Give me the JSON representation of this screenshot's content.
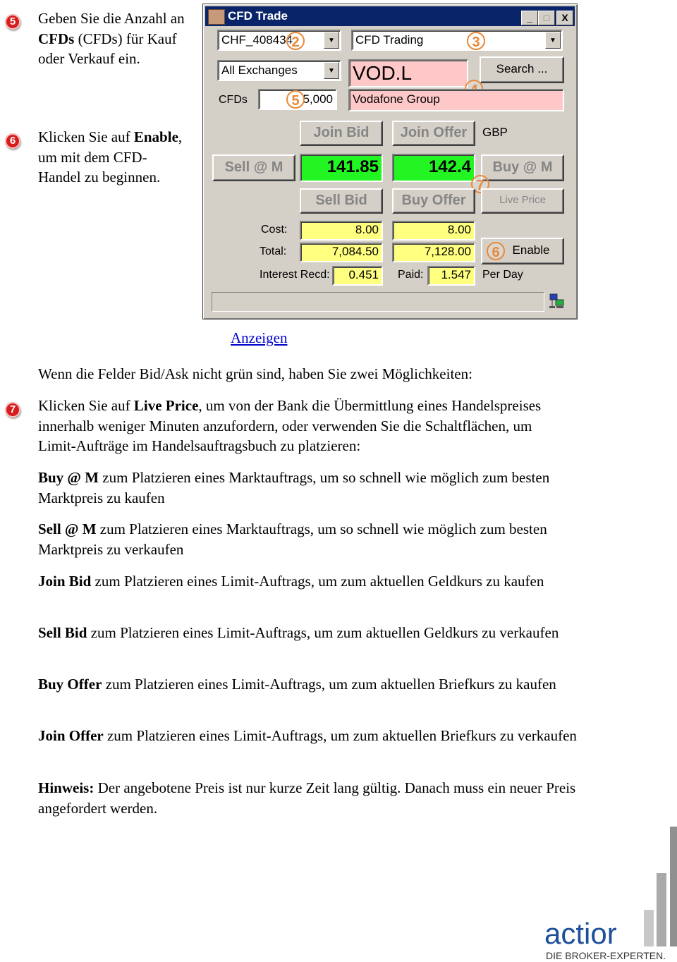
{
  "steps": {
    "step5": {
      "number": "5",
      "text_before": "Geben Sie die Anzahl an ",
      "bold": "CFDs",
      "text_after": " (CFDs) für Kauf oder Verkauf ein."
    },
    "step6": {
      "number": "6",
      "text_before": "Klicken Sie auf ",
      "bold": "Enable",
      "text_after": ", um mit dem CFD-Handel zu beginnen."
    }
  },
  "window": {
    "title": "CFD Trade",
    "minimize": "_",
    "maximize": "□",
    "close": "X",
    "account_select": "CHF_408434",
    "product_select": "CFD Trading",
    "exchange_select": "All Exchanges",
    "symbol": "VOD.L",
    "search_button": "Search ...",
    "cfds_label": "CFDs",
    "cfds_value": "5,000",
    "instrument_name": "Vodafone Group",
    "join_bid": "Join Bid",
    "join_offer": "Join Offer",
    "currency": "GBP",
    "sell_at_market": "Sell @ M",
    "bid_price": "141.85",
    "offer_price": "142.4",
    "buy_at_market": "Buy @ M",
    "sell_bid": "Sell Bid",
    "buy_offer": "Buy Offer",
    "live_price": "Live Price",
    "cost_label": "Cost:",
    "cost_bid": "8.00",
    "cost_offer": "8.00",
    "total_label": "Total:",
    "total_bid": "7,084.50",
    "total_offer": "7,128.00",
    "enable_button": "Enable",
    "interest_label": "Interest Recd:",
    "interest_recd": "0.451",
    "paid_label": "Paid:",
    "paid": "1.547",
    "per_day": "Per Day",
    "status_text": "",
    "callouts": [
      "2",
      "3",
      "4",
      "5",
      "6",
      "7"
    ]
  },
  "link": "Anzeigen",
  "intro": "Wenn die Felder Bid/Ask nicht grün sind, haben Sie zwei Möglichkeiten:",
  "step7": {
    "number": "7",
    "text_before": "Klicken Sie auf ",
    "bold": "Live Price",
    "text_after": ", um von der Bank die Übermittlung eines Handelspreises innerhalb weniger Minuten anzufordern, oder verwenden Sie die Schaltflächen, um Limit-Aufträge im Handelsauftragsbuch zu platzieren:"
  },
  "definitions": [
    {
      "term": "Buy @ M",
      "text": " zum Platzieren eines Marktauftrags, um so schnell wie möglich zum besten Marktpreis zu kaufen"
    },
    {
      "term": "Sell @ M",
      "text": " zum Platzieren eines Marktauftrags, um so schnell wie möglich zum besten Marktpreis zu verkaufen"
    },
    {
      "term": "Join Bid",
      "text": " zum Platzieren eines Limit-Auftrags, um zum aktuellen Geldkurs zu kaufen"
    },
    {
      "term": "Sell Bid",
      "text": " zum Platzieren eines Limit-Auftrags, um zum aktuellen Geldkurs zu verkaufen"
    },
    {
      "term": "Buy Offer",
      "text": " zum Platzieren eines Limit-Auftrags, um zum aktuellen Briefkurs zu kaufen"
    },
    {
      "term": "Join Offer",
      "text": " zum Platzieren eines Limit-Auftrags, um zum aktuellen Briefkurs zu verkaufen"
    },
    {
      "term": "Hinweis:",
      "text": " Der angebotene Preis ist nur kurze Zeit lang gültig. Danach muss ein neuer Preis angefordert werden."
    }
  ],
  "logo": {
    "name": "actior",
    "tagline": "DIE BROKER-EXPERTEN.",
    "brand_color": "#1d4f9a"
  },
  "colors": {
    "title_bar": "#0a246a",
    "price_green": "#22f522",
    "field_yellow": "#ffff80",
    "field_pink": "#ffc8c8",
    "callout_orange": "#e8893a",
    "bullet_red": "#d81c1c",
    "link_blue": "#0000cc"
  }
}
